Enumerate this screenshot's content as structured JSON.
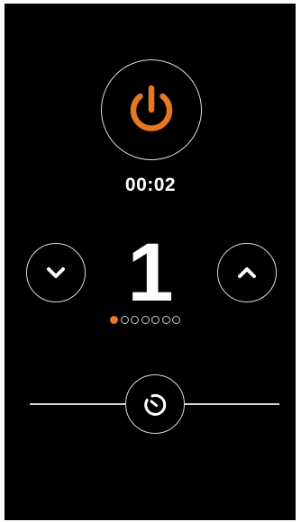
{
  "theme": {
    "accent": "#e87722",
    "background": "#000000",
    "foreground": "#ffffff",
    "outline": "#d9d9d9"
  },
  "power": {
    "icon": "power-icon",
    "color": "#e87722"
  },
  "timer": {
    "text": "00:02"
  },
  "level": {
    "value": "1",
    "current": 1,
    "max": 7,
    "down_icon": "chevron-down-icon",
    "up_icon": "chevron-up-icon"
  },
  "timer_slider": {
    "icon": "stopwatch-icon"
  }
}
